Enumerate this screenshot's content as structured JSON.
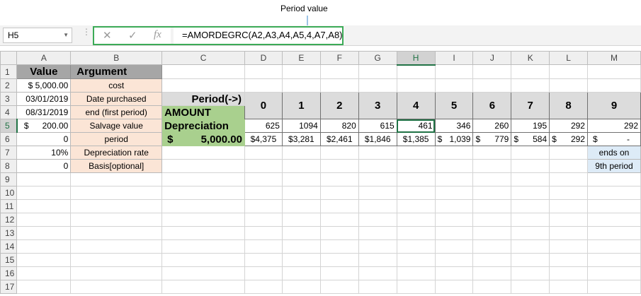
{
  "annotation": {
    "label": "Period value"
  },
  "name_box": "H5",
  "formula_bar": {
    "cancel": "✕",
    "enter": "✓",
    "fx": "fx",
    "formula": "=AMORDEGRC(A2,A3,A4,A5,4,A7,A8)"
  },
  "columns": [
    "A",
    "B",
    "C",
    "D",
    "E",
    "F",
    "G",
    "H",
    "I",
    "J",
    "K",
    "L",
    "M"
  ],
  "rows": [
    "1",
    "2",
    "3",
    "4",
    "5",
    "6",
    "7",
    "8",
    "9",
    "10",
    "11",
    "12",
    "13",
    "14",
    "15",
    "16",
    "17"
  ],
  "cells": {
    "A1": "Value",
    "B1": "Argument",
    "A2": "$ 5,000.00",
    "B2": "cost",
    "A3": "03/01/2019",
    "B3": "Date purchased",
    "A4": "08/31/2019",
    "B4": "end (first period)",
    "A5_cur": "$",
    "A5_val": "200.00",
    "B5": "Salvage value",
    "A6": "0",
    "B6": "period",
    "A7": "10%",
    "B7": "Depreciation rate",
    "A8": "0",
    "B8": "Basis[optional]",
    "C3": "Period(->)",
    "C4": "AMOUNT",
    "C5": "Depreciation",
    "C6_cur": "$",
    "C6_val": "5,000.00",
    "periods": [
      "0",
      "1",
      "2",
      "3",
      "4",
      "5",
      "6",
      "7",
      "8",
      "9"
    ],
    "depreciation": [
      "625",
      "1094",
      "820",
      "615",
      "461",
      "346",
      "260",
      "195",
      "292",
      "292"
    ],
    "amount_cur": [
      "",
      "",
      "",
      "",
      "",
      "$",
      "$",
      "$",
      "$",
      "$"
    ],
    "amounts": [
      "$4,375",
      "$3,281",
      "$2,461",
      "$1,846",
      "$1,385",
      "1,039",
      "779",
      "584",
      "292",
      "-"
    ],
    "M7": "ends on",
    "M8": "9th period"
  }
}
